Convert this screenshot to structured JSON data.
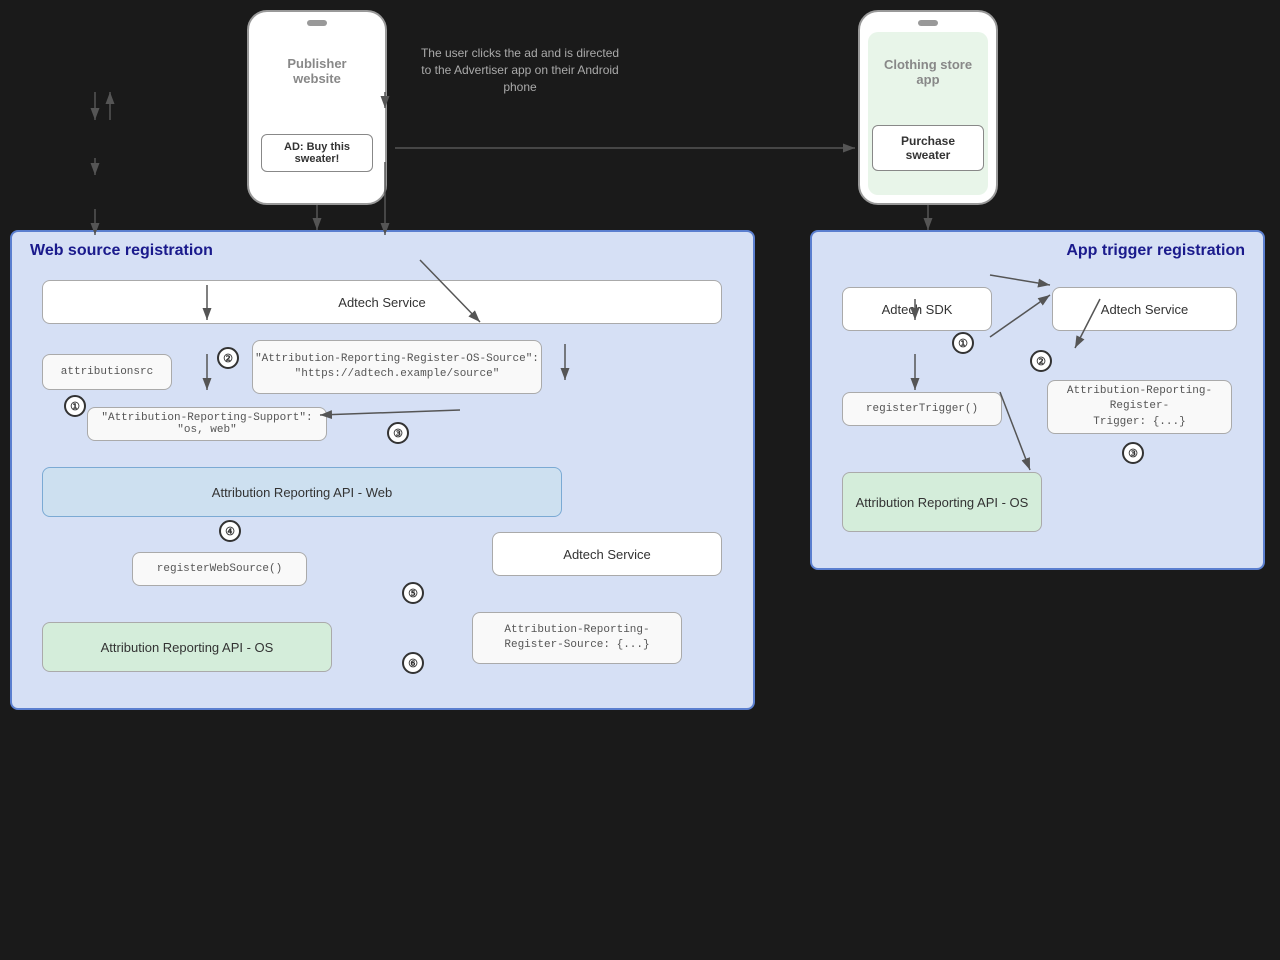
{
  "publisher": {
    "title": "Publisher\nwebsite",
    "ad_label": "AD:\nBuy this\nsweater!"
  },
  "clothing": {
    "title": "Clothing store\napp",
    "purchase_label": "Purchase\nsweater"
  },
  "user_click_text": "The user clicks the ad and is\ndirected to the Advertiser app on\ntheir Android phone",
  "web_source": {
    "section_label": "Web source registration",
    "adtech_service_top": "Adtech Service",
    "attributionsrc": "attributionsrc",
    "attribution_header": "\"Attribution-Reporting-Register-OS-Source\":\n\"https://adtech.example/source\"",
    "support_header": "\"Attribution-Reporting-Support\": \"os, web\"",
    "api_web": "Attribution Reporting API - Web",
    "step4_label": "registerWebSource()",
    "adtech_service_bottom": "Adtech Service",
    "attr_register_source": "Attribution-Reporting-\nRegister-Source: {...}",
    "api_os": "Attribution Reporting API - OS"
  },
  "app_trigger": {
    "section_label": "App trigger registration",
    "adtech_sdk": "Adtech SDK",
    "register_trigger": "registerTrigger()",
    "adtech_service": "Adtech Service",
    "attr_register_trigger": "Attribution-Reporting-Register-\nTrigger: {...}",
    "api_os": "Attribution Reporting API - OS"
  },
  "steps": {
    "web": [
      "①",
      "②",
      "③",
      "④",
      "⑤",
      "⑥"
    ],
    "app": [
      "①",
      "②",
      "③"
    ]
  }
}
